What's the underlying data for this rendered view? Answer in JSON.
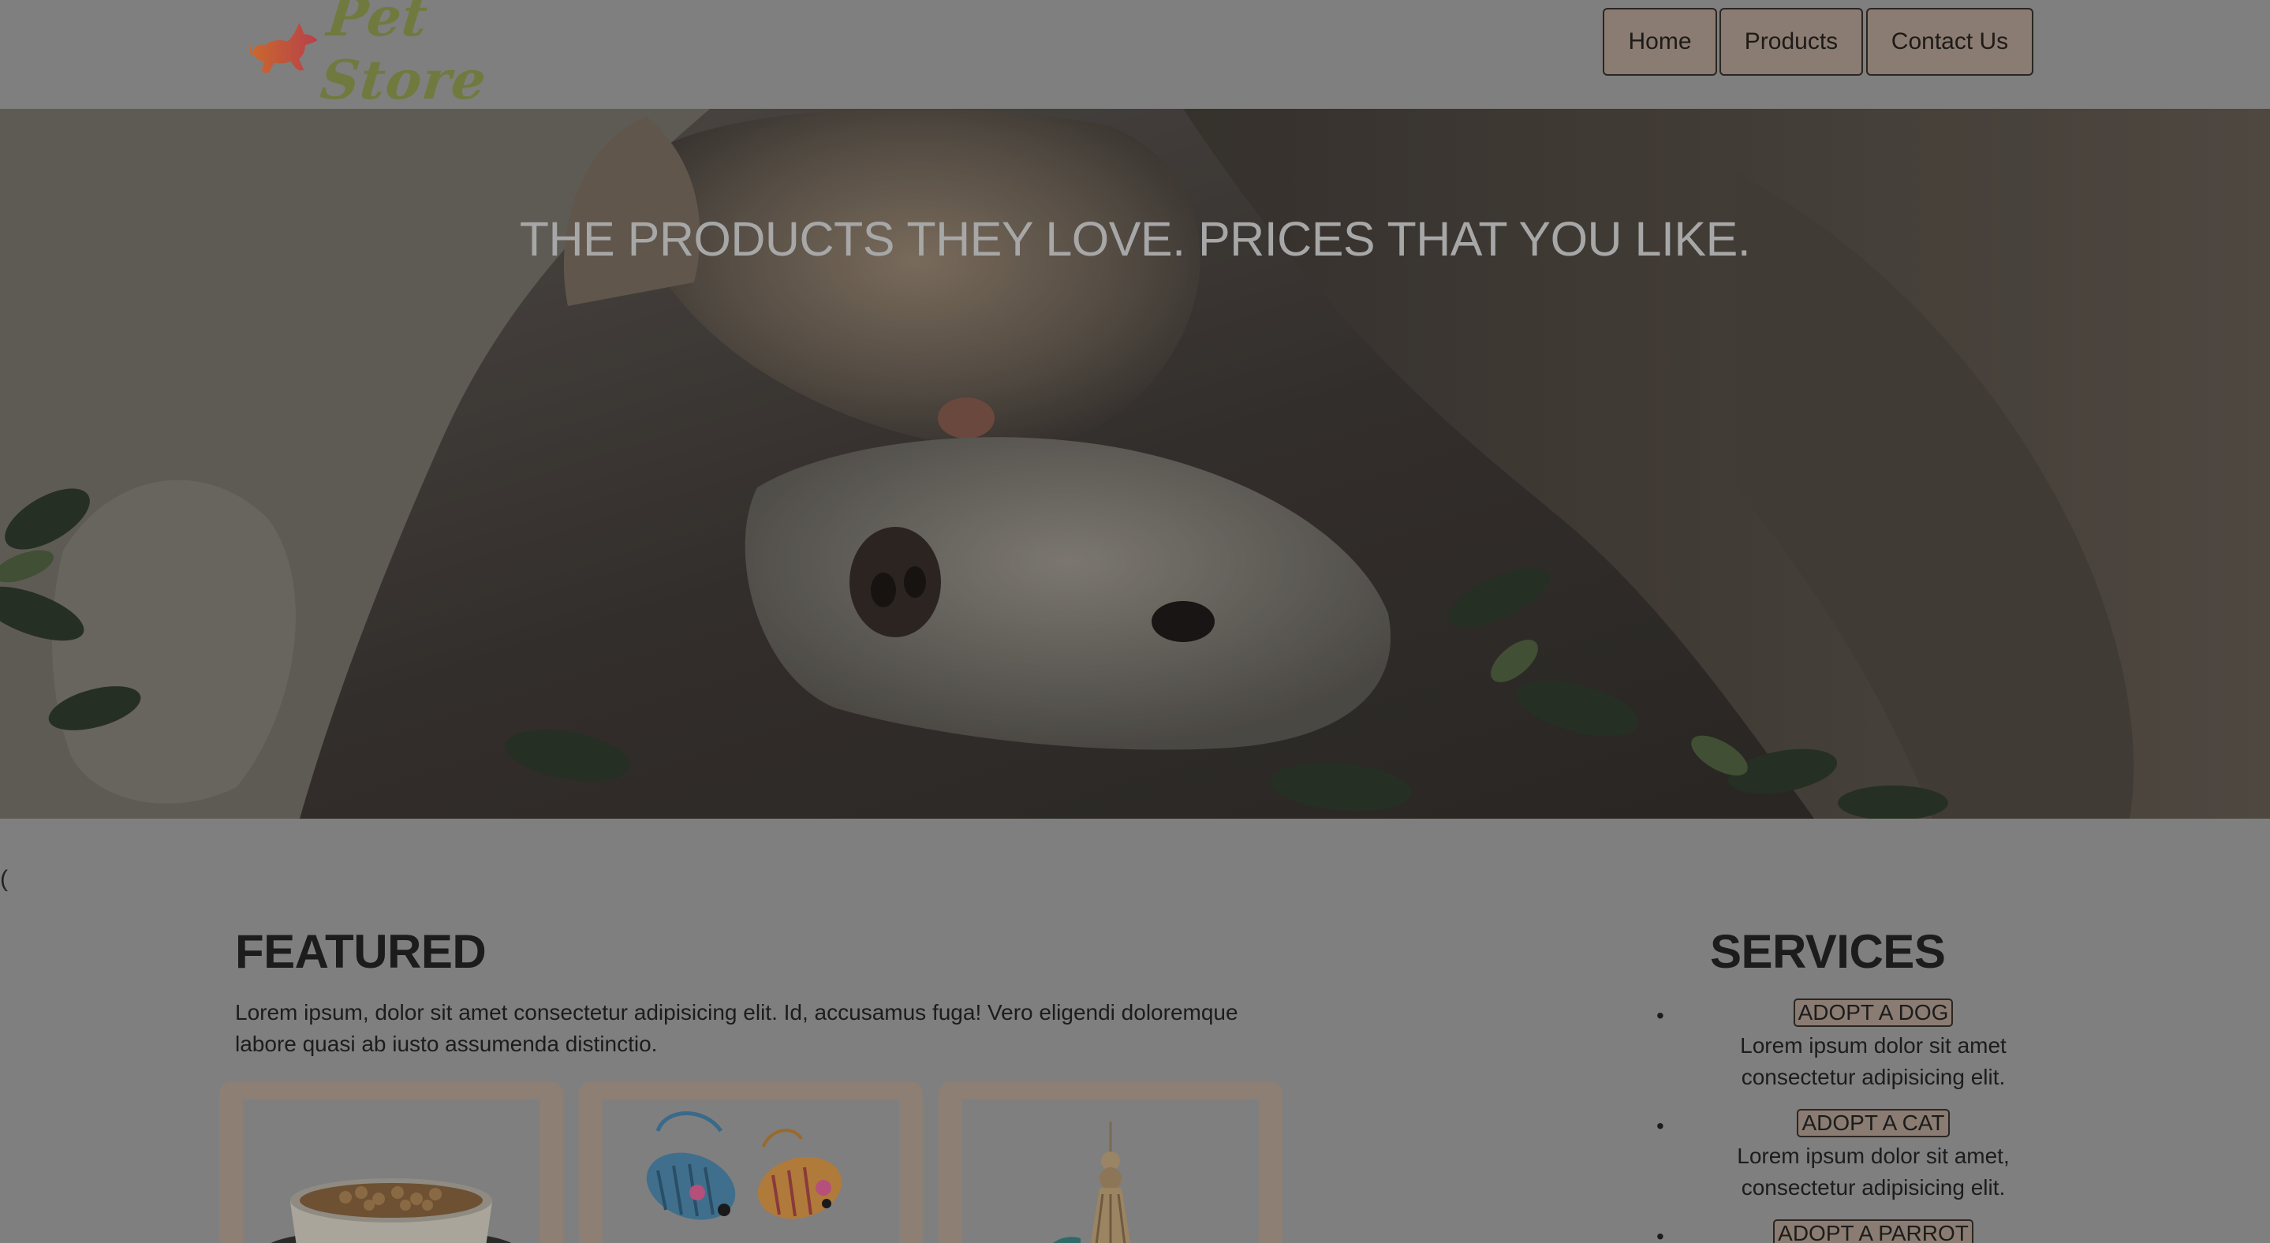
{
  "header": {
    "logo_text": "Pet Store",
    "logo_icon": "running-dog-icon",
    "nav": [
      {
        "label": "Home"
      },
      {
        "label": "Products"
      },
      {
        "label": "Contact Us"
      }
    ]
  },
  "hero": {
    "tagline": "THE PRODUCTS THEY LOVE. PRICES THAT YOU LIKE.",
    "image": "cat-and-dog-cuddling-photo"
  },
  "stray_text": "(",
  "featured": {
    "title": "FEATURED",
    "text": "Lorem ipsum, dolor sit amet consectetur adipisicing elit. Id, accusamus fuga! Vero eligendi doloremque labore quasi ab iusto assumenda distinctio.",
    "cards": [
      {
        "image": "pet-food-bowl-image"
      },
      {
        "image": "toy-mice-image"
      },
      {
        "image": "bird-toy-image"
      }
    ]
  },
  "services": {
    "title": "SERVICES",
    "items": [
      {
        "label": "ADOPT A DOG",
        "desc": "Lorem ipsum dolor sit amet consectetur adipisicing elit."
      },
      {
        "label": "ADOPT A CAT",
        "desc": "Lorem ipsum dolor sit amet, consectetur adipisicing elit."
      },
      {
        "label": "ADOPT A PARROT",
        "desc": ""
      }
    ]
  },
  "colors": {
    "overlay_gray": "#7f7f7f",
    "logo_green": "#707a3e",
    "logo_dog_orange": "#c65a3c",
    "button_brown": "#8a7c72",
    "card_brown": "#8d7f73"
  }
}
